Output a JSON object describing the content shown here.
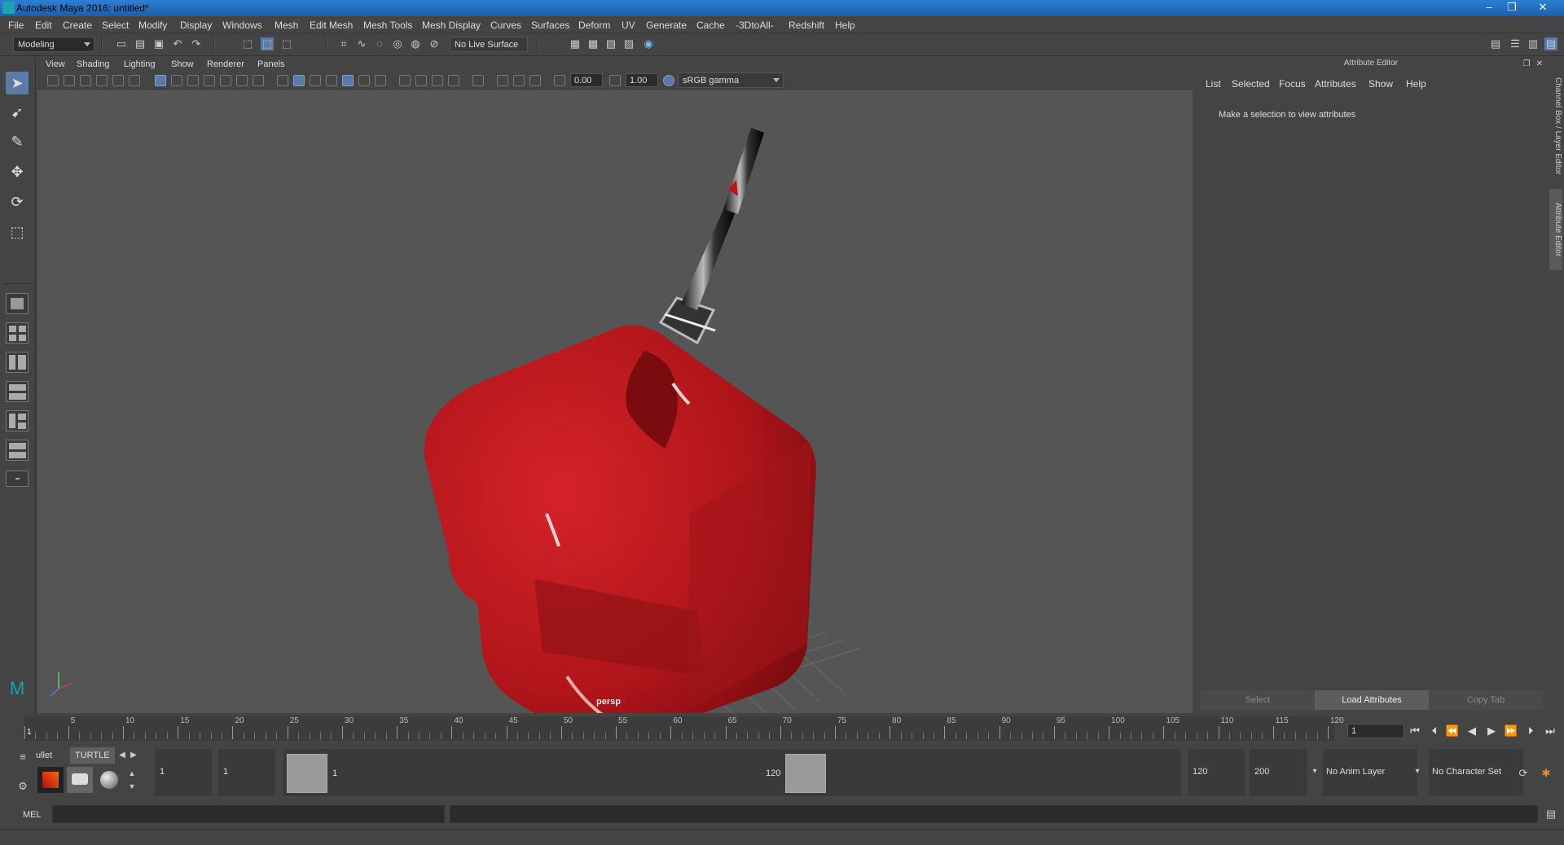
{
  "window": {
    "title": "Autodesk Maya 2016: untitled*",
    "minimize": "‒",
    "restore": "❐",
    "close": "✕"
  },
  "menubar": [
    "File",
    "Edit",
    "Create",
    "Select",
    "Modify",
    "Display",
    "Windows",
    "Mesh",
    "Edit Mesh",
    "Mesh Tools",
    "Mesh Display",
    "Curves",
    "Surfaces",
    "Deform",
    "UV",
    "Generate",
    "Cache",
    "-3DtoAll-",
    "Redshift",
    "Help"
  ],
  "statusline": {
    "menuset": "Modeling",
    "live_surface": "No Live Surface"
  },
  "viewport": {
    "menu": [
      "View",
      "Shading",
      "Lighting",
      "Show",
      "Renderer",
      "Panels"
    ],
    "exposure": "0.00",
    "gamma": "1.00",
    "colorspace": "sRGB gamma",
    "camera_label": "persp"
  },
  "attribute_editor": {
    "title": "Attribute Editor",
    "menu": [
      "List",
      "Selected",
      "Focus",
      "Attributes",
      "Show",
      "Help"
    ],
    "message": "Make a selection to view attributes",
    "buttons": {
      "select": "Select",
      "load": "Load Attributes",
      "copy": "Copy Tab"
    }
  },
  "side_tabs": {
    "channel_box": "Channel Box / Layer Editor",
    "attribute_editor": "Attribute Editor"
  },
  "time_slider": {
    "labels": [
      "1",
      "5",
      "10",
      "15",
      "20",
      "25",
      "30",
      "35",
      "40",
      "45",
      "50",
      "55",
      "60",
      "65",
      "70",
      "75",
      "80",
      "85",
      "90",
      "95",
      "100",
      "105",
      "110",
      "115",
      "120"
    ],
    "current_frame": "1"
  },
  "shelf": {
    "tabs": [
      "ullet",
      "TURTLE"
    ]
  },
  "range": {
    "start": "1",
    "anim_start": "1",
    "slider_start": "1",
    "slider_end": "120",
    "anim_end": "120",
    "end": "200",
    "anim_layer": "No Anim Layer",
    "character_set": "No Character Set"
  },
  "command_line": {
    "lang": "MEL"
  }
}
